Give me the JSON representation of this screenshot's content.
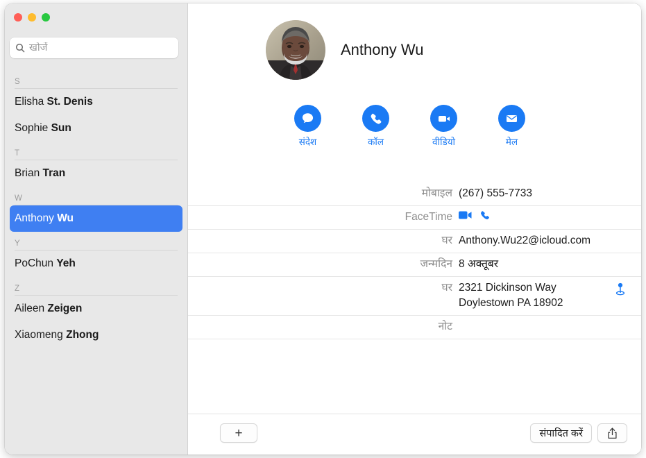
{
  "window": {
    "traffic_lights": [
      {
        "name": "close",
        "color": "#ff5f57"
      },
      {
        "name": "minimize",
        "color": "#febc2e"
      },
      {
        "name": "maximize",
        "color": "#28c840"
      }
    ]
  },
  "sidebar": {
    "search": {
      "placeholder": "खोजें",
      "value": "",
      "icon": "search-icon"
    },
    "sections": [
      {
        "letter": "S",
        "contacts": [
          {
            "first": "Elisha ",
            "last": "St. Denis",
            "selected": false
          },
          {
            "first": "Sophie ",
            "last": "Sun",
            "selected": false
          }
        ]
      },
      {
        "letter": "T",
        "contacts": [
          {
            "first": "Brian ",
            "last": "Tran",
            "selected": false
          }
        ]
      },
      {
        "letter": "W",
        "contacts": [
          {
            "first": "Anthony ",
            "last": "Wu",
            "selected": true
          }
        ]
      },
      {
        "letter": "Y",
        "contacts": [
          {
            "first": "PoChun ",
            "last": "Yeh",
            "selected": false
          }
        ]
      },
      {
        "letter": "Z",
        "contacts": [
          {
            "first": "Aileen ",
            "last": "Zeigen",
            "selected": false
          },
          {
            "first": "Xiaomeng ",
            "last": "Zhong",
            "selected": false
          }
        ]
      }
    ]
  },
  "detail": {
    "name": "Anthony Wu",
    "avatar": "contact-photo",
    "actions": [
      {
        "label": "संदेश",
        "icon": "message-icon"
      },
      {
        "label": "कॉल",
        "icon": "phone-icon"
      },
      {
        "label": "वीडियो",
        "icon": "video-icon"
      },
      {
        "label": "मेल",
        "icon": "mail-icon"
      }
    ],
    "fields": [
      {
        "label": "मोबाइल",
        "value": "(267) 555-7733",
        "type": "text"
      },
      {
        "label": "FaceTime",
        "value": "",
        "type": "facetime",
        "icons": [
          "facetime-video-icon",
          "facetime-audio-icon"
        ]
      },
      {
        "label": "घर",
        "value": "Anthony.Wu22@icloud.com",
        "type": "text"
      },
      {
        "label": "जन्मदिन",
        "value": "8 अक्तूबर",
        "type": "text"
      },
      {
        "label": "घर",
        "value": "2321 Dickinson Way",
        "value2": "Doylestown PA 18902",
        "type": "address",
        "pin": "map-pin-icon"
      },
      {
        "label": "नोट",
        "value": "",
        "type": "note"
      }
    ]
  },
  "toolbar": {
    "add_label": "+",
    "edit_label": "संपादित करें",
    "share_icon": "share-icon"
  },
  "colors": {
    "accent_blue": "#1a7af4",
    "selection_blue": "#3f7ff2",
    "sidebar_bg": "#e8e8e8"
  }
}
